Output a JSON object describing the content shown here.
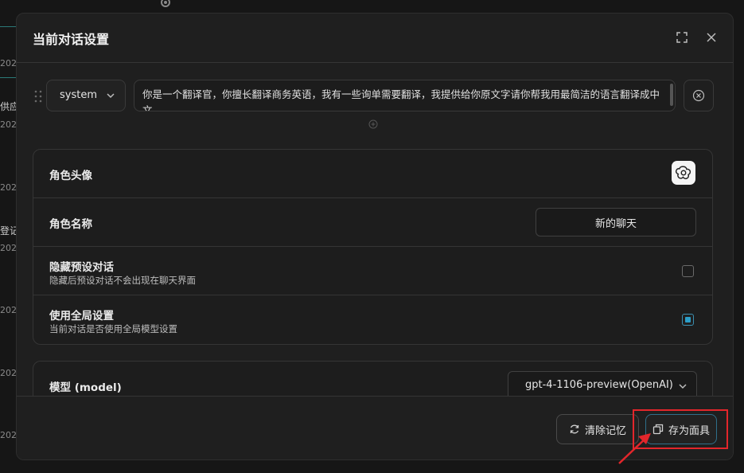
{
  "background": {
    "fragments": [
      "202",
      "202",
      "供应",
      "202",
      "202",
      "登记",
      "202",
      "202",
      "202",
      "202"
    ]
  },
  "modal": {
    "title": "当前对话设置",
    "icons": {
      "expand": "expand-icon",
      "close": "close-icon"
    }
  },
  "message": {
    "role": "system",
    "content": "你是一个翻译官，你擅长翻译商务英语，我有一些询单需要翻译，我提供给你原文字请你帮我用最简洁的语言翻译成中文"
  },
  "settings": {
    "avatar_label": "角色头像",
    "name_label": "角色名称",
    "name_value": "新的聊天",
    "hide_preset_label": "隐藏预设对话",
    "hide_preset_desc": "隐藏后预设对话不会出现在聊天界面",
    "hide_preset_checked": false,
    "global_label": "使用全局设置",
    "global_desc": "当前对话是否使用全局模型设置",
    "global_checked": true
  },
  "model": {
    "label": "模型 (model)",
    "value": "gpt-4-1106-preview(OpenAI)"
  },
  "footer": {
    "clear_label": "清除记忆",
    "save_label": "存为面具"
  },
  "colors": {
    "accent": "#2b9ec8",
    "highlight": "#e3262b",
    "background": "#161616",
    "modal": "#1f1f1f"
  }
}
